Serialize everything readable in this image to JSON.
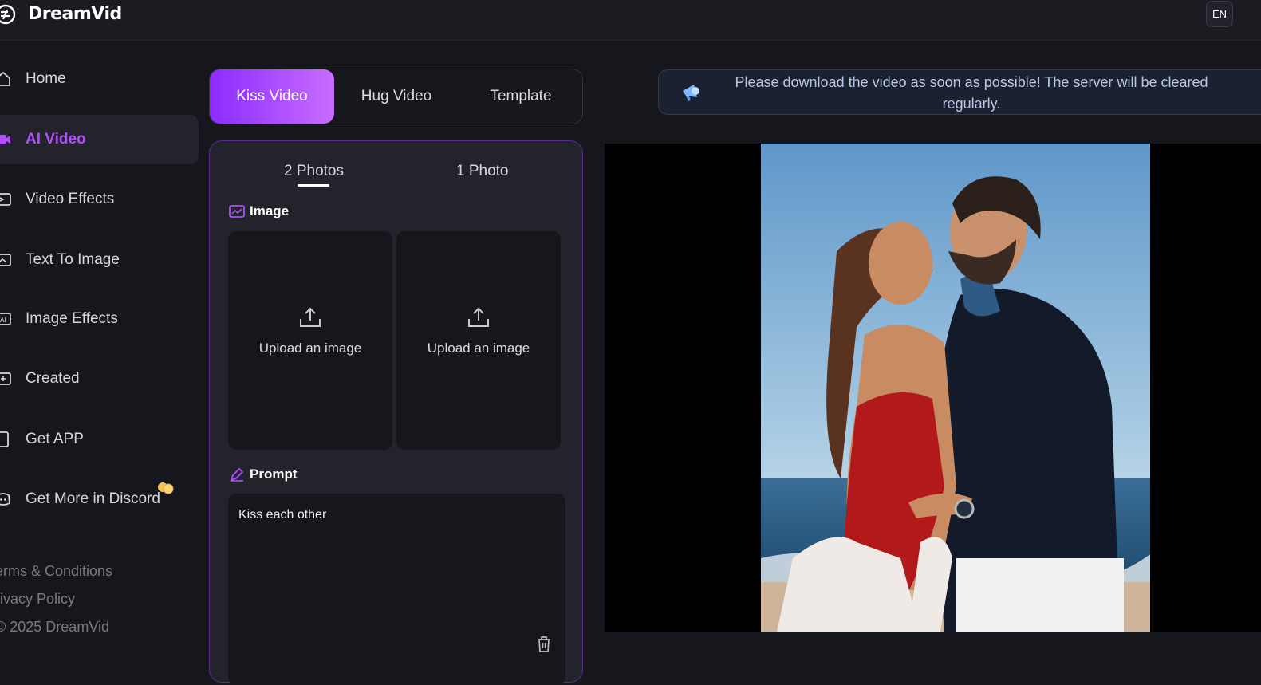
{
  "app": {
    "name": "DreamVid",
    "language": "EN"
  },
  "sidebar": {
    "items": [
      {
        "label": "Home",
        "icon": "home-icon"
      },
      {
        "label": "AI Video",
        "icon": "video-icon",
        "active": true
      },
      {
        "label": "Video Effects",
        "icon": "video-effects-icon"
      },
      {
        "label": "Text To Image",
        "icon": "text-to-image-icon"
      },
      {
        "label": "Image Effects",
        "icon": "image-effects-icon"
      },
      {
        "label": "Created",
        "icon": "created-icon"
      },
      {
        "label": "Get APP",
        "icon": "phone-icon"
      },
      {
        "label": "Get More in Discord",
        "icon": "discord-icon"
      }
    ],
    "footer": {
      "terms": "erms & Conditions",
      "privacy": "rivacy Policy",
      "copyright": "© 2025 DreamVid"
    }
  },
  "mode_tabs": [
    {
      "label": "Kiss Video",
      "active": true
    },
    {
      "label": "Hug Video"
    },
    {
      "label": "Template"
    }
  ],
  "panel": {
    "photo_tabs": [
      {
        "label": "2 Photos",
        "active": true
      },
      {
        "label": "1 Photo"
      }
    ],
    "image_section_title": "Image",
    "upload_label": "Upload an image",
    "prompt_section_title": "Prompt",
    "prompt_value": "Kiss each other"
  },
  "notice": {
    "text": "Please download the video as soon as possible! The server will be cleared regularly."
  },
  "colors": {
    "accent": "#b04dff",
    "gradient_start": "#8b2bff",
    "gradient_end": "#c86dff",
    "background": "#16171c"
  }
}
